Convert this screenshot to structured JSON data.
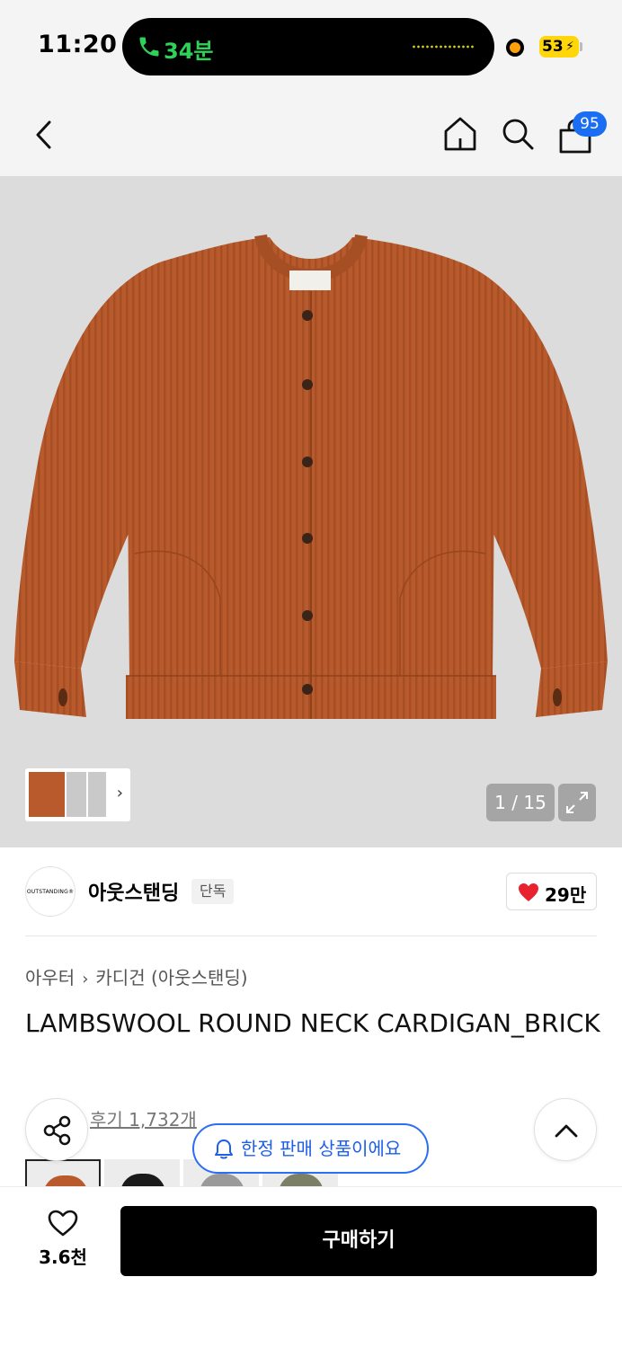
{
  "status_bar": {
    "time": "11:20",
    "call_duration": "34분",
    "battery": "53"
  },
  "nav": {
    "cart_badge": "95"
  },
  "gallery": {
    "counter": "1 / 15"
  },
  "brand": {
    "logo_text": "OUTSTANDING®",
    "name": "아웃스탠딩",
    "tag": "단독",
    "likes": "29만"
  },
  "breadcrumb": {
    "level1": "아우터",
    "level2": "카디건 (아웃스탠딩)"
  },
  "product": {
    "title": "LAMBSWOOL ROUND NECK CARDIGAN_BRICK",
    "review_label": "후기 1,732개"
  },
  "notice": {
    "limited_label": "한정 판매 상품이에요"
  },
  "bottom_bar": {
    "wish_count": "3.6천",
    "buy_label": "구매하기"
  },
  "colors": {
    "accent_blue": "#1b6ef3",
    "heart_red": "#e8232f",
    "product_brick": "#b85a2c"
  }
}
